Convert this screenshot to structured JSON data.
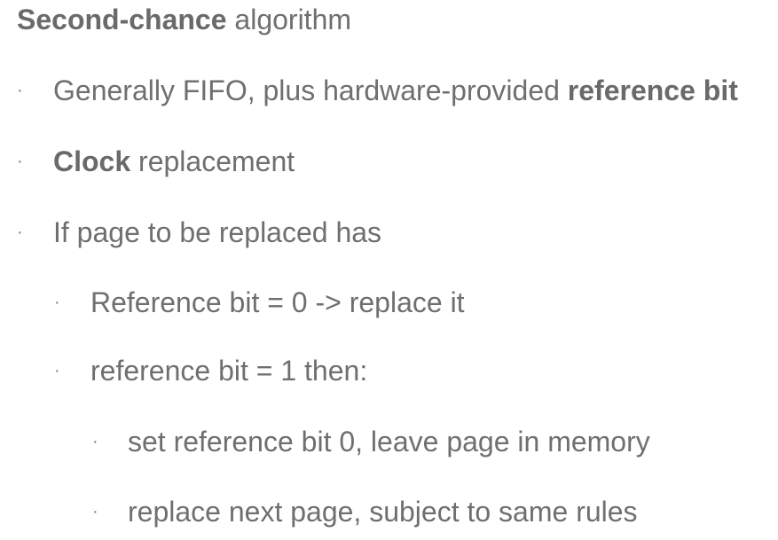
{
  "title": {
    "bold": "Second-chance",
    "rest": " algorithm"
  },
  "bullets": [
    {
      "level": 1,
      "segments": [
        {
          "text": "Generally FIFO, plus hardware-provided ",
          "bold": false
        },
        {
          "text": "reference bit",
          "bold": true
        }
      ]
    },
    {
      "level": 1,
      "segments": [
        {
          "text": "Clock",
          "bold": true
        },
        {
          "text": " replacement",
          "bold": false
        }
      ]
    },
    {
      "level": 1,
      "segments": [
        {
          "text": "If page to be replaced has",
          "bold": false
        }
      ]
    },
    {
      "level": 2,
      "segments": [
        {
          "text": "Reference bit = 0 -> replace it",
          "bold": false
        }
      ]
    },
    {
      "level": 2,
      "segments": [
        {
          "text": "reference bit = 1 then:",
          "bold": false
        }
      ]
    },
    {
      "level": 3,
      "segments": [
        {
          "text": "set reference bit 0, leave page in memory",
          "bold": false
        }
      ]
    },
    {
      "level": 3,
      "segments": [
        {
          "text": "replace next page, subject to same rules",
          "bold": false
        }
      ]
    }
  ],
  "bullet_glyph": "·",
  "colors": {
    "text": "#6f6f6f",
    "background": "#ffffff"
  }
}
